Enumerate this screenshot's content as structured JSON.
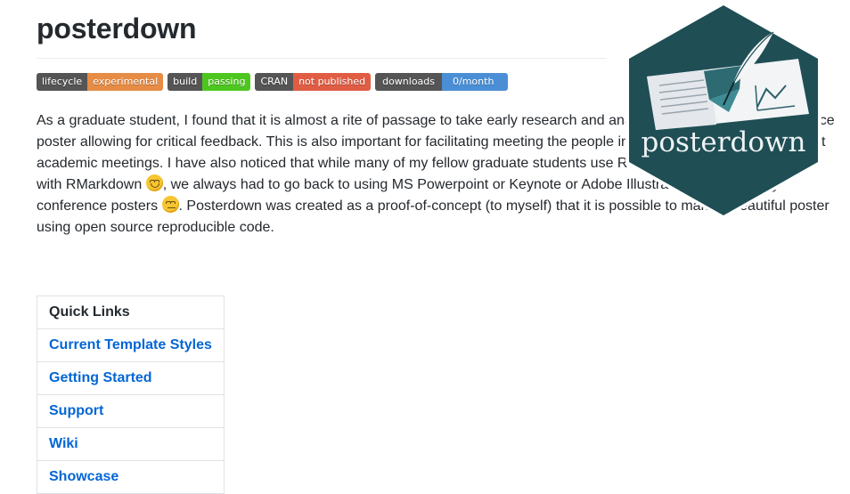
{
  "page": {
    "title": "posterdown"
  },
  "badges": [
    {
      "label": "lifecycle",
      "value": "experimental",
      "color": "#e68c45"
    },
    {
      "label": "build",
      "value": "passing",
      "color": "#4dc71f"
    },
    {
      "label": "CRAN",
      "value": "not published",
      "color": "#e05d44"
    },
    {
      "label": "downloads",
      "value": "0/month",
      "color": "#4a8fd6"
    }
  ],
  "intro": {
    "part1": "As a graduate student, I found that it is almost a rite of passage to take early research and analysis and generate a conference poster allowing for critical feedback. This is also important for facilitating meeting the people in your field at poster sessions at academic meetings. I have also noticed that while many of my fellow graduate students use R and are getting their feet wet with RMarkdown",
    "emoji1": "blush-emoji",
    "part2": ", we always had to go back to using MS Powerpoint or Keynote or Adobe Illustrator for generating conference posters",
    "emoji2": "unamused-emoji",
    "part3": ". Posterdown was created as a proof-of-concept (to myself) that it is possible to make a beautiful poster using open source reproducible code."
  },
  "quick_links": {
    "header": "Quick Links",
    "items": [
      {
        "label": "Current Template Styles"
      },
      {
        "label": "Getting Started"
      },
      {
        "label": "Support"
      },
      {
        "label": "Wiki"
      },
      {
        "label": "Showcase"
      }
    ]
  },
  "logo": {
    "text": "posterdown",
    "bg_color": "#1f4e55",
    "border_color": "#ffffff"
  }
}
